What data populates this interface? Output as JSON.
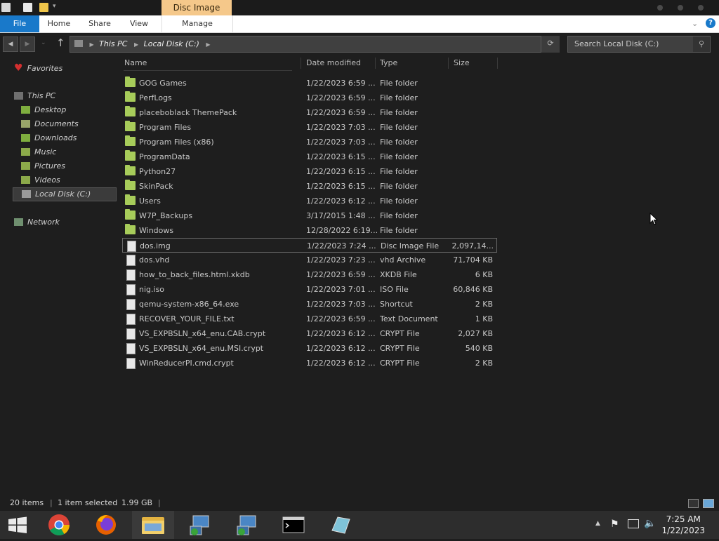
{
  "ribbon": {
    "contextual_tab": "Disc Image Tools",
    "tabs": {
      "file": "File",
      "home": "Home",
      "share": "Share",
      "view": "View",
      "manage": "Manage"
    }
  },
  "address": {
    "crumbs": [
      "This PC",
      "Local Disk (C:)"
    ],
    "search_placeholder": "Search Local Disk (C:)"
  },
  "navpane": {
    "favorites": "Favorites",
    "this_pc": "This PC",
    "items": [
      "Desktop",
      "Documents",
      "Downloads",
      "Music",
      "Pictures",
      "Videos",
      "Local Disk (C:)"
    ],
    "network": "Network"
  },
  "columns": {
    "name": "Name",
    "date": "Date modified",
    "type": "Type",
    "size": "Size"
  },
  "files": [
    {
      "name": "GOG Games",
      "date": "1/22/2023 6:59 ...",
      "type": "File folder",
      "size": ""
    },
    {
      "name": "PerfLogs",
      "date": "1/22/2023 6:59 ...",
      "type": "File folder",
      "size": ""
    },
    {
      "name": "placeboblack ThemePack",
      "date": "1/22/2023 6:59 ...",
      "type": "File folder",
      "size": ""
    },
    {
      "name": "Program Files",
      "date": "1/22/2023 7:03 ...",
      "type": "File folder",
      "size": ""
    },
    {
      "name": "Program Files (x86)",
      "date": "1/22/2023 7:03 ...",
      "type": "File folder",
      "size": ""
    },
    {
      "name": "ProgramData",
      "date": "1/22/2023 6:15 ...",
      "type": "File folder",
      "size": ""
    },
    {
      "name": "Python27",
      "date": "1/22/2023 6:15 ...",
      "type": "File folder",
      "size": ""
    },
    {
      "name": "SkinPack",
      "date": "1/22/2023 6:15 ...",
      "type": "File folder",
      "size": ""
    },
    {
      "name": "Users",
      "date": "1/22/2023 6:12 ...",
      "type": "File folder",
      "size": ""
    },
    {
      "name": "W7P_Backups",
      "date": "3/17/2015 1:48 ...",
      "type": "File folder",
      "size": ""
    },
    {
      "name": "Windows",
      "date": "12/28/2022 6:19...",
      "type": "File folder",
      "size": ""
    },
    {
      "name": "dos.img",
      "date": "1/22/2023 7:24 ...",
      "type": "Disc Image File",
      "size": "2,097,14..."
    },
    {
      "name": "dos.vhd",
      "date": "1/22/2023 7:23 ...",
      "type": "vhd Archive",
      "size": "71,704 KB"
    },
    {
      "name": "how_to_back_files.html.xkdb",
      "date": "1/22/2023 6:59 ...",
      "type": "XKDB File",
      "size": "6 KB"
    },
    {
      "name": "nig.iso",
      "date": "1/22/2023 7:01 ...",
      "type": "ISO File",
      "size": "60,846 KB"
    },
    {
      "name": "qemu-system-x86_64.exe",
      "date": "1/22/2023 7:03 ...",
      "type": "Shortcut",
      "size": "2 KB"
    },
    {
      "name": "RECOVER_YOUR_FILE.txt",
      "date": "1/22/2023 6:59 ...",
      "type": "Text Document",
      "size": "1 KB"
    },
    {
      "name": "VS_EXPBSLN_x64_enu.CAB.crypt",
      "date": "1/22/2023 6:12 ...",
      "type": "CRYPT File",
      "size": "2,027 KB"
    },
    {
      "name": "VS_EXPBSLN_x64_enu.MSI.crypt",
      "date": "1/22/2023 6:12 ...",
      "type": "CRYPT File",
      "size": "540 KB"
    },
    {
      "name": "WinReducerPI.cmd.crypt",
      "date": "1/22/2023 6:12 ...",
      "type": "CRYPT File",
      "size": "2 KB"
    }
  ],
  "status": {
    "items": "20 items",
    "selected": "1 item selected",
    "size": "1.99 GB"
  },
  "clock": {
    "time": "7:25 AM",
    "date": "1/22/2023"
  }
}
